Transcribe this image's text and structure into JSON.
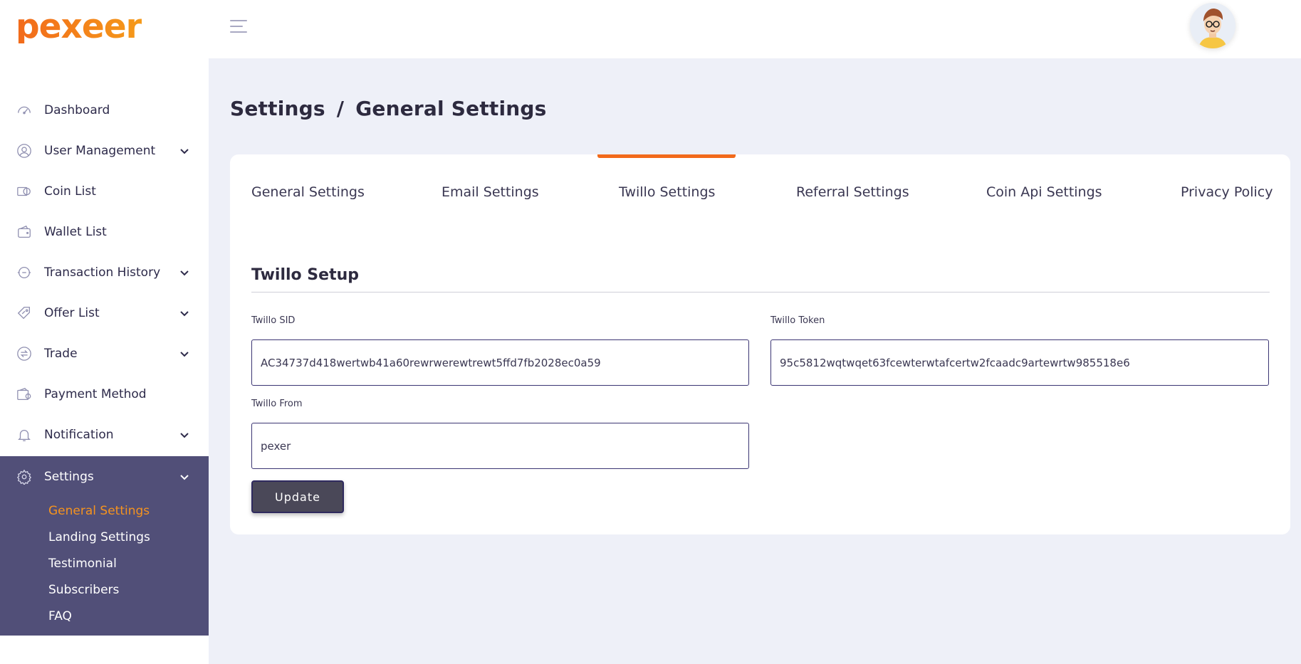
{
  "brand": {
    "logo_text": "pexeer",
    "accent": "#f26a1b"
  },
  "sidebar": {
    "items": [
      {
        "label": "Dashboard",
        "icon": "dashboard-icon",
        "has_children": false
      },
      {
        "label": "User Management",
        "icon": "user-icon",
        "has_children": true
      },
      {
        "label": "Coin List",
        "icon": "coin-icon",
        "has_children": false
      },
      {
        "label": "Wallet List",
        "icon": "wallet-icon",
        "has_children": false
      },
      {
        "label": "Transaction History",
        "icon": "transaction-icon",
        "has_children": true
      },
      {
        "label": "Offer List",
        "icon": "offer-tag-icon",
        "has_children": true
      },
      {
        "label": "Trade",
        "icon": "trade-exchange-icon",
        "has_children": true
      },
      {
        "label": "Payment Method",
        "icon": "payment-icon",
        "has_children": false
      },
      {
        "label": "Notification",
        "icon": "bell-icon",
        "has_children": true
      }
    ],
    "settings": {
      "label": "Settings",
      "icon": "gear-icon",
      "submenu": [
        "General Settings",
        "Landing Settings",
        "Testimonial",
        "Subscribers",
        "FAQ"
      ],
      "active_sub": "General Settings",
      "bg_color": "#514f78",
      "active_color": "#f5931f"
    }
  },
  "header": {
    "menu_icon": "hamburger-icon",
    "avatar": "user-avatar"
  },
  "breadcrumb": {
    "parent": "Settings",
    "separator": "/",
    "current": "General Settings"
  },
  "tabs": {
    "items": [
      "General Settings",
      "Email Settings",
      "Twillo Settings",
      "Referral Settings",
      "Coin Api Settings",
      "Privacy Policy"
    ],
    "active": "Twillo Settings"
  },
  "form": {
    "section_title": "Twillo Setup",
    "sid_label": "Twillo SID",
    "sid_value": "AC34737d418wertwb41a60rewrwerewtrewt5ffd7fb2028ec0a59",
    "token_label": "Twillo Token",
    "token_value": "95c5812wqtwqet63fcewterwtafcertw2fcaadc9artewrtw985518e6",
    "from_label": "Twillo From",
    "from_value": "pexer",
    "update_label": "Update"
  }
}
